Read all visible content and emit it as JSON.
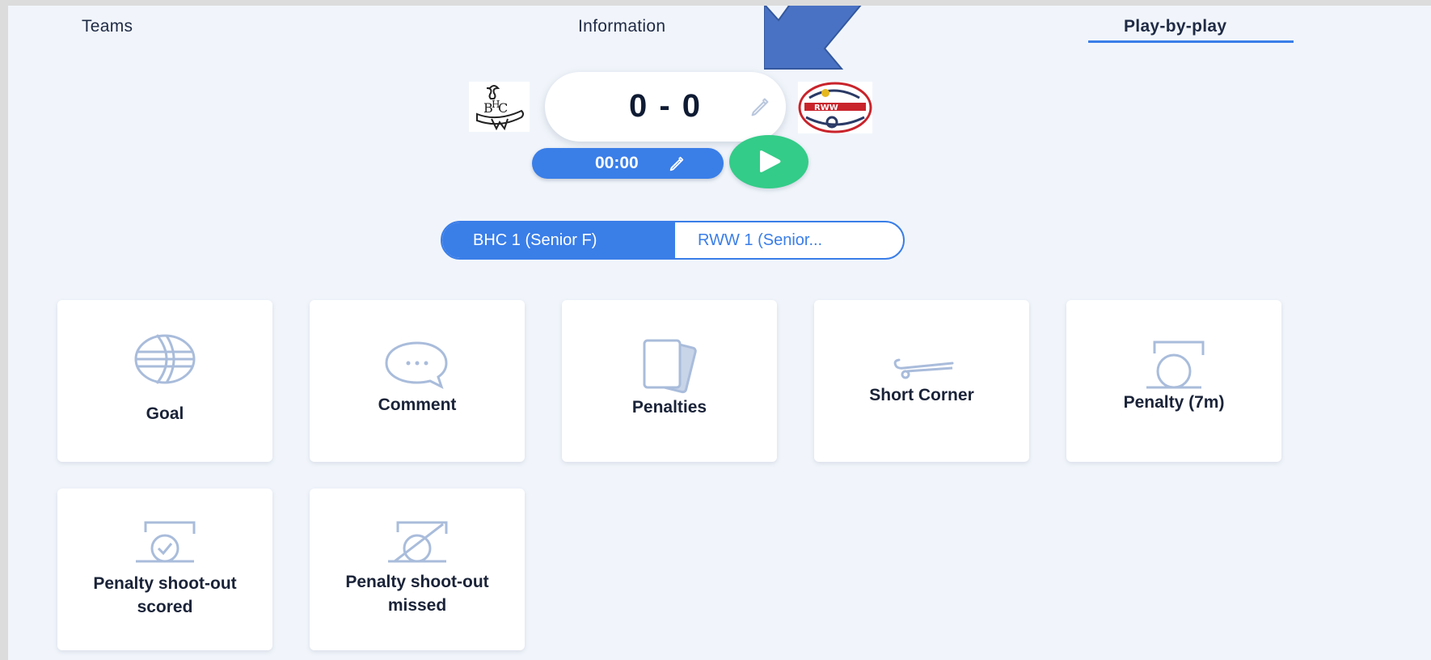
{
  "tabs": {
    "teams": "Teams",
    "information": "Information",
    "play_by_play": "Play-by-play"
  },
  "score": {
    "display": "0 - 0"
  },
  "clock": {
    "display": "00:00"
  },
  "team_toggle": {
    "home": "BHC 1 (Senior F)",
    "away": "RWW 1 (Senior..."
  },
  "actions": {
    "goal": "Goal",
    "comment": "Comment",
    "penalties": "Penalties",
    "short_corner": "Short Corner",
    "penalty_7m": "Penalty (7m)",
    "shootout_scored_1": "Penalty shoot-out",
    "shootout_scored_2": "scored",
    "shootout_missed_1": "Penalty shoot-out",
    "shootout_missed_2": "missed"
  },
  "colors": {
    "accent": "#3a7ee8",
    "play": "#33cc88",
    "icon": "#a9bcdb",
    "background": "#f1f5fb",
    "annotation_arrow": "#4a72c4"
  },
  "icons": {
    "annotation": "arrow-down-left-icon",
    "score_edit": "pencil-icon",
    "clock_edit": "pencil-icon",
    "play": "play-icon"
  }
}
